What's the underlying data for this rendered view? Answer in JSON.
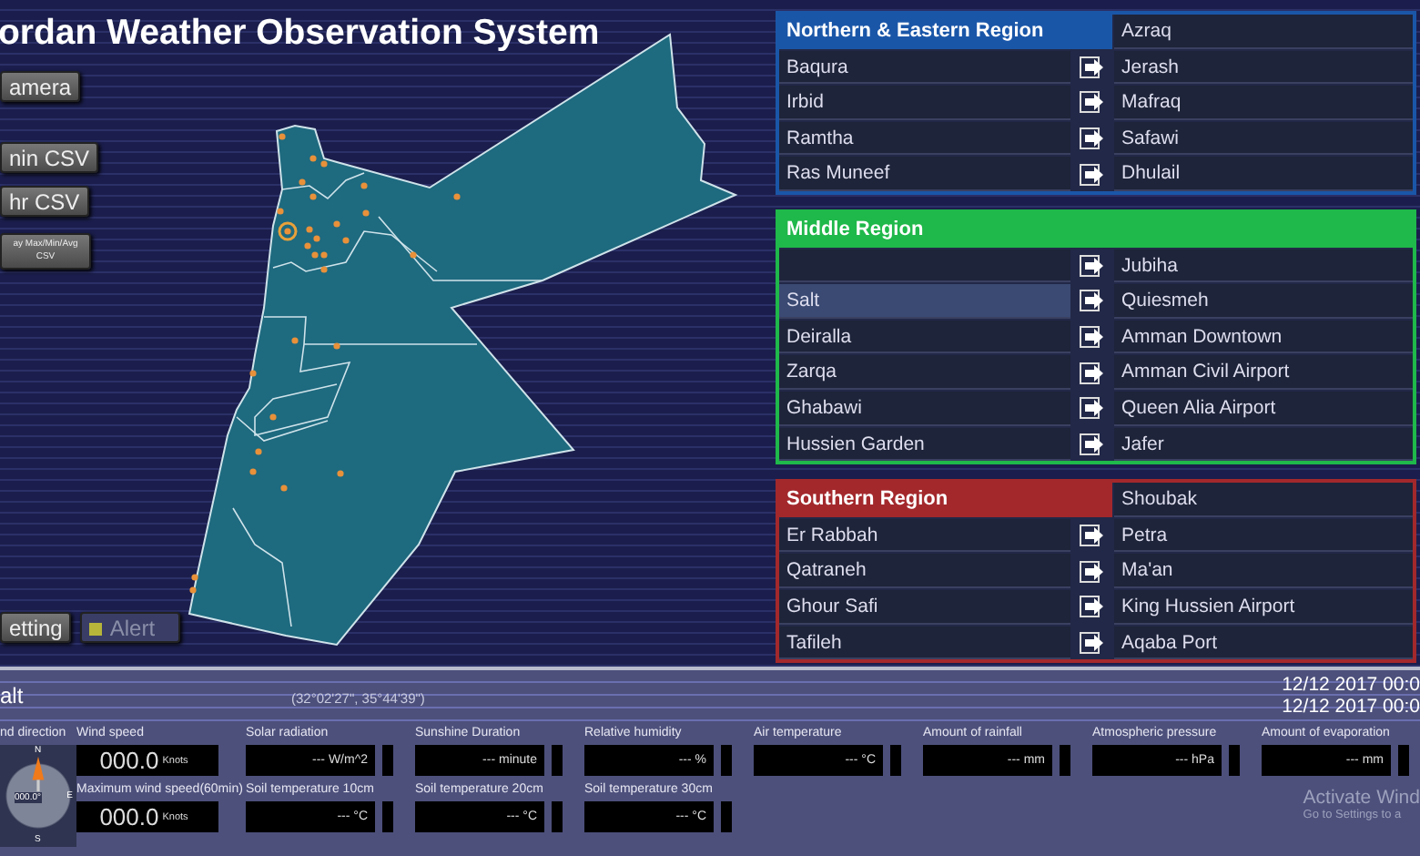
{
  "title": "ordan Weather Observation System",
  "side_buttons": [
    {
      "label": "amera",
      "kind": "normal"
    },
    {
      "label": "nin CSV",
      "kind": "normal"
    },
    {
      "label": "hr CSV",
      "kind": "normal"
    },
    {
      "label": "ay Max/Min/Avg CSV",
      "kind": "small"
    }
  ],
  "bottom_buttons": [
    {
      "label": "etting",
      "kind": "plain",
      "disabled": false
    },
    {
      "label": "Alert",
      "kind": "indicator",
      "disabled": true
    }
  ],
  "regions": [
    {
      "title": "Northern & Eastern Region",
      "kind": "split",
      "color": "#1a56a8",
      "left": [
        {
          "name": "Baqura",
          "selected": false
        },
        {
          "name": "Irbid",
          "selected": false
        },
        {
          "name": "Ramtha",
          "selected": false
        },
        {
          "name": "Ras Muneef",
          "selected": false
        }
      ],
      "right": [
        "Azraq",
        "Jerash",
        "Mafraq",
        "Safawi",
        "Dhulail"
      ]
    },
    {
      "title": "Middle Region",
      "kind": "full",
      "color": "#1fb84a",
      "left": [
        {
          "selected": false
        },
        {
          "name": "Salt",
          "selected": true
        },
        {
          "name": "Deiralla",
          "selected": false
        },
        {
          "name": "Zarqa",
          "selected": false
        },
        {
          "name": "Ghabawi",
          "selected": false
        },
        {
          "name": "Hussien Garden",
          "selected": false
        }
      ],
      "right": [
        "Jubiha",
        "Quiesmeh",
        "Amman Downtown",
        "Amman Civil Airport",
        "Queen Alia Airport",
        "Jafer"
      ]
    },
    {
      "title": "Southern Region",
      "kind": "split",
      "color": "#a3282c",
      "left": [
        {
          "name": "Er Rabbah",
          "selected": false
        },
        {
          "name": "Qatraneh",
          "selected": false
        },
        {
          "name": "Ghour Safi",
          "selected": false
        },
        {
          "name": "Tafileh",
          "selected": false
        }
      ],
      "right": [
        "Shoubak",
        "Petra",
        "Ma'an",
        "King Hussien Airport",
        "Aqaba Port"
      ]
    }
  ],
  "station": {
    "name": "alt",
    "coordinates": "(32°02'27\", 35°44'39\")",
    "timestamps": [
      "12/12 2017 00:0",
      "12/12 2017 00:0"
    ]
  },
  "wind_direction": {
    "label": "nd direction",
    "value": "000.0°",
    "compass_labels": [
      "N",
      "E",
      "S"
    ]
  },
  "wind": [
    {
      "label": "Wind speed",
      "value": "000.0",
      "unit": "Knots"
    },
    {
      "label": "Maximum wind speed(60min)",
      "value": "000.0",
      "unit": "Knots"
    }
  ],
  "sensor_rows": [
    [
      {
        "label": "Solar radiation",
        "value": "---",
        "unit": "W/m^2"
      },
      {
        "label": "Sunshine Duration",
        "value": "---",
        "unit": "minute"
      },
      {
        "label": "Relative humidity",
        "value": "---",
        "unit": "%"
      },
      {
        "label": "Air temperature",
        "value": "---",
        "unit": "°C"
      },
      {
        "label": "Amount of rainfall",
        "value": "---",
        "unit": "mm"
      },
      {
        "label": "Atmospheric pressure",
        "value": "---",
        "unit": "hPa"
      },
      {
        "label": "Amount of evaporation",
        "value": "---",
        "unit": "mm"
      }
    ],
    [
      {
        "label": "Soil temperature 10cm",
        "value": "---",
        "unit": "°C"
      },
      {
        "label": "Soil temperature 20cm",
        "value": "---",
        "unit": "°C"
      },
      {
        "label": "Soil temperature 30cm",
        "value": "---",
        "unit": "°C"
      }
    ]
  ],
  "os_notice": {
    "title": "Activate Wind",
    "subtitle": "Go to Settings to a"
  }
}
